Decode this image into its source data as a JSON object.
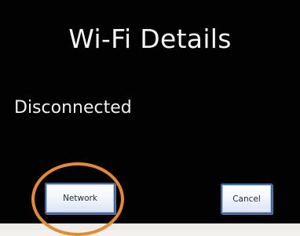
{
  "dialog": {
    "title": "Wi-Fi Details",
    "status": "Disconnected"
  },
  "buttons": {
    "network_label": "Network",
    "cancel_label": "Cancel"
  },
  "annotation": {
    "highlight_color": "#e9892e",
    "highlight_shape": "circle",
    "highlight_target": "network-button"
  },
  "colors": {
    "screen_background": "#020202",
    "text": "#f4f4f4",
    "button_border": "#3f67a7"
  }
}
